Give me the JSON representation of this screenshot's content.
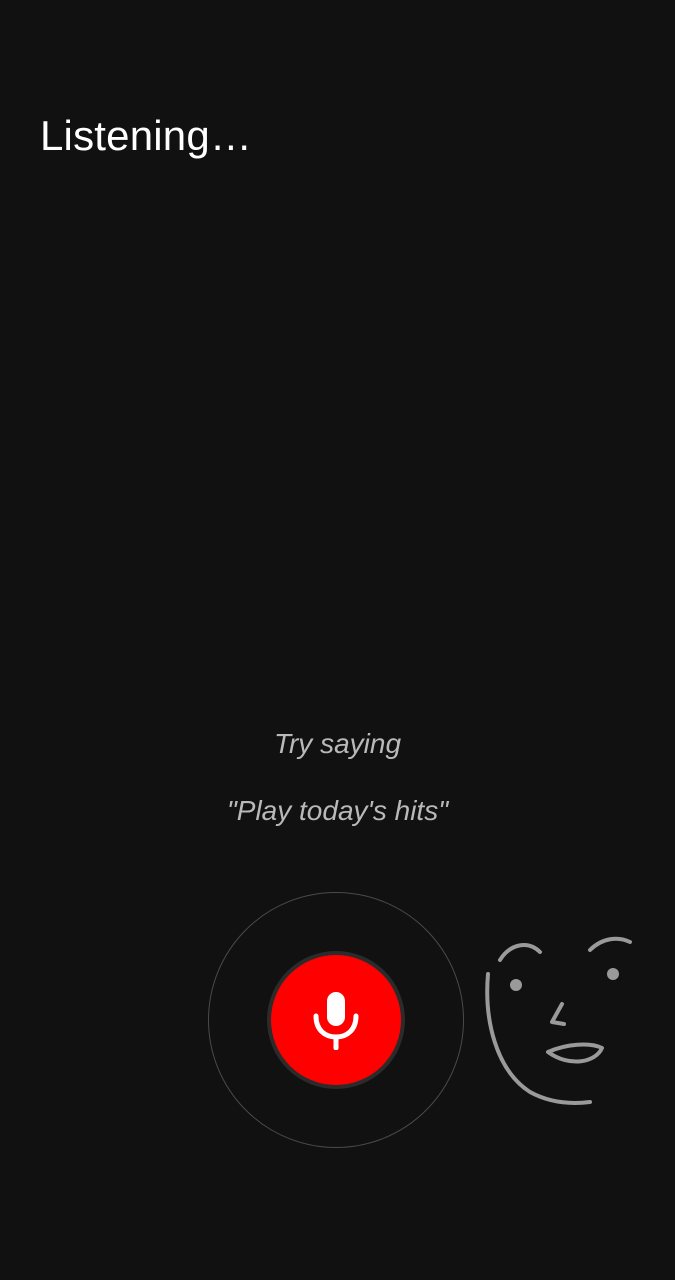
{
  "status": {
    "title": "Listening…"
  },
  "hint": {
    "heading": "Try saying",
    "example": "\"Play today's hits\""
  },
  "mic_button": {
    "icon": "microphone-icon",
    "color": "#ff0000"
  },
  "decoration": {
    "icon": "face-doodle-icon"
  },
  "colors": {
    "background": "#111111",
    "text": "#ffffff",
    "hint_text": "#b9b9b9",
    "accent": "#ff0000"
  }
}
